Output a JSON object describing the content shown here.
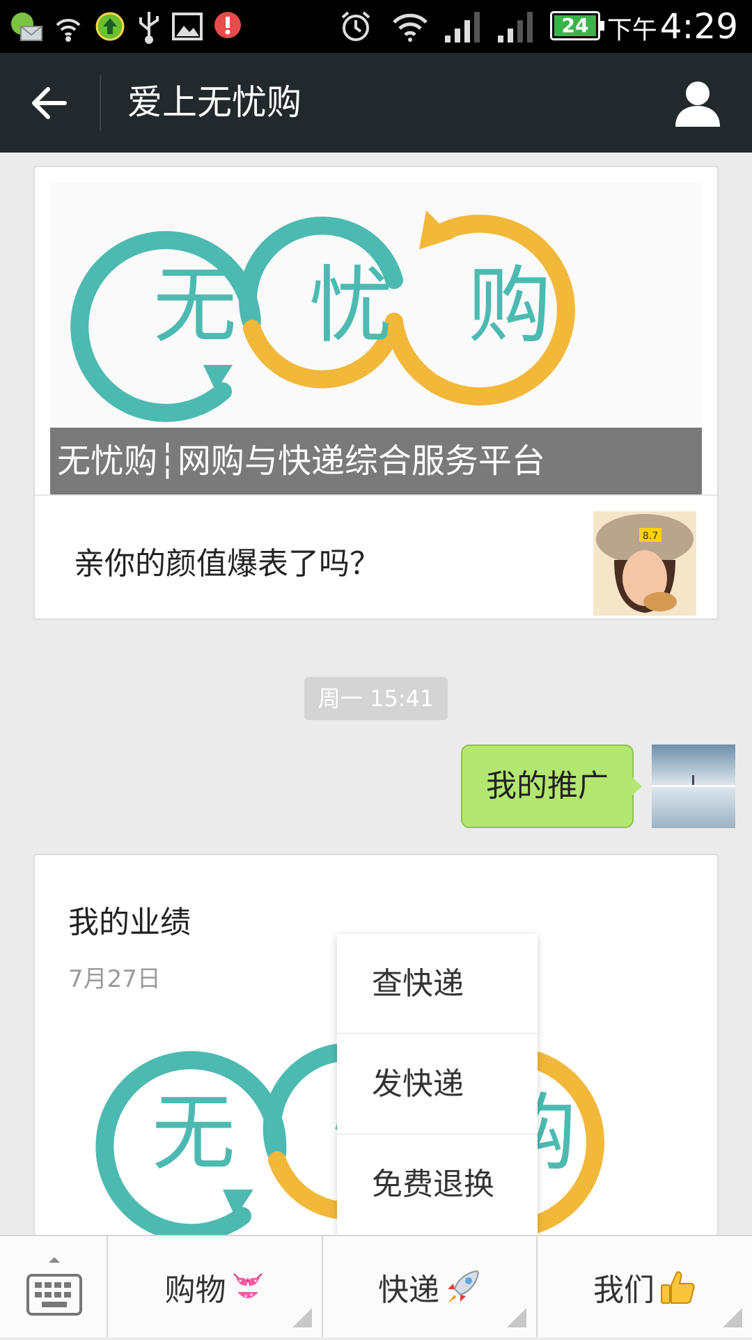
{
  "status_bar": {
    "ampm": "下午",
    "time": "4:29",
    "battery": "24",
    "icons": [
      "mail-notification-icon",
      "wifi-hotspot-icon",
      "upload-icon",
      "usb-icon",
      "image-icon",
      "alert-icon",
      "alarm-icon",
      "wifi-icon",
      "signal-icon",
      "signal-icon-2",
      "battery-icon"
    ]
  },
  "title_bar": {
    "title": "爱上无忧购"
  },
  "chat": {
    "banner_card": {
      "logo_chars": [
        "无",
        "忧",
        "购"
      ],
      "caption": "无忧购┆网购与快递综合服务平台",
      "article_title": "亲你的颜值爆表了吗？",
      "thumb_badge": "8.7"
    },
    "timestamp": "周一 15:41",
    "sent_message": "我的推广",
    "performance_card": {
      "title": "我的业绩",
      "date": "7月27日",
      "logo_chars": [
        "无",
        "忧",
        "购"
      ]
    }
  },
  "popup_menu": {
    "items": [
      "查快递",
      "发快递",
      "免费退换"
    ]
  },
  "bottom_menu": {
    "items": [
      {
        "label": "购物",
        "icon": "bikini-icon"
      },
      {
        "label": "快递",
        "icon": "rocket-icon"
      },
      {
        "label": "我们",
        "icon": "thumbs-up-icon"
      }
    ]
  },
  "colors": {
    "teal": "#4dbab1",
    "gold": "#f1b83a",
    "bubble": "#b3e771",
    "titlebar": "#22292c"
  }
}
